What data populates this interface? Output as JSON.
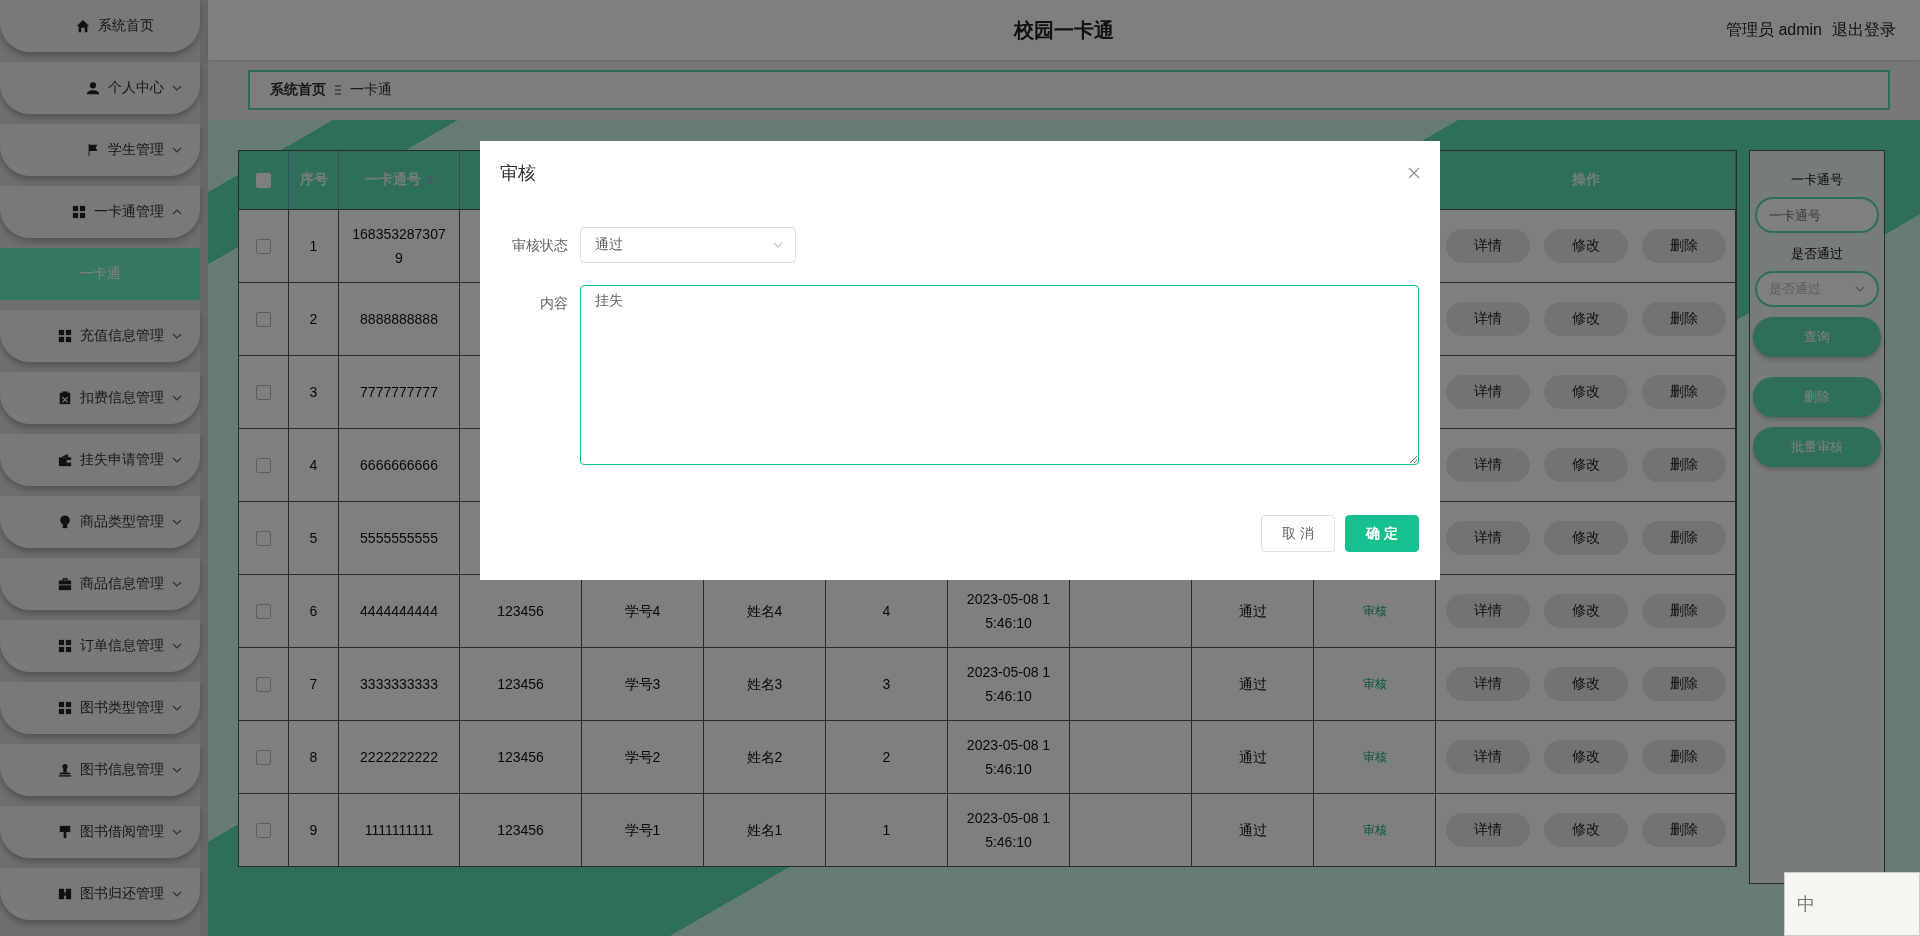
{
  "header": {
    "title": "校园一卡通",
    "user": "管理员 admin",
    "logout": "退出登录"
  },
  "sidebar": {
    "items": [
      {
        "label": "系统首页",
        "kind": "link"
      },
      {
        "label": "个人中心",
        "kind": "menu",
        "expanded": false
      },
      {
        "label": "学生管理",
        "kind": "menu",
        "expanded": false
      },
      {
        "label": "一卡通管理",
        "kind": "menu",
        "expanded": true,
        "children": [
          {
            "label": "一卡通",
            "selected": true
          }
        ]
      },
      {
        "label": "充值信息管理",
        "kind": "menu",
        "expanded": false
      },
      {
        "label": "扣费信息管理",
        "kind": "menu",
        "expanded": false
      },
      {
        "label": "挂失申请管理",
        "kind": "menu",
        "expanded": false
      },
      {
        "label": "商品类型管理",
        "kind": "menu",
        "expanded": false
      },
      {
        "label": "商品信息管理",
        "kind": "menu",
        "expanded": false
      },
      {
        "label": "订单信息管理",
        "kind": "menu",
        "expanded": false
      },
      {
        "label": "图书类型管理",
        "kind": "menu",
        "expanded": false
      },
      {
        "label": "图书信息管理",
        "kind": "menu",
        "expanded": false
      },
      {
        "label": "图书借阅管理",
        "kind": "menu",
        "expanded": false
      },
      {
        "label": "图书归还管理",
        "kind": "menu",
        "expanded": false
      }
    ]
  },
  "breadcrumb": [
    "系统首页",
    "一卡通"
  ],
  "table": {
    "select_all_checked": false,
    "header": {
      "seq": "序号",
      "card_no": "一卡通号",
      "actions": "操作"
    },
    "rows": [
      {
        "checked": false,
        "seq": "1",
        "card_no": "1683532873079",
        "actions": [
          "详情",
          "修改",
          "删除"
        ]
      },
      {
        "checked": false,
        "seq": "2",
        "card_no": "8888888888",
        "actions": [
          "详情",
          "修改",
          "删除"
        ]
      },
      {
        "checked": false,
        "seq": "3",
        "card_no": "7777777777",
        "actions": [
          "详情",
          "修改",
          "删除"
        ]
      },
      {
        "checked": false,
        "seq": "4",
        "card_no": "6666666666",
        "actions": [
          "详情",
          "修改",
          "删除"
        ]
      },
      {
        "checked": false,
        "seq": "5",
        "card_no": "5555555555",
        "actions": [
          "详情",
          "修改",
          "删除"
        ]
      },
      {
        "checked": false,
        "seq": "6",
        "card_no": "4444444444",
        "column_4": "123456",
        "column_5": "学号4",
        "column_6": "姓名4",
        "column_7": "4",
        "column_8": "2023-05-08 15:46:10",
        "status": "通过",
        "audit_link": "审核",
        "actions": [
          "详情",
          "修改",
          "删除"
        ]
      },
      {
        "checked": false,
        "seq": "7",
        "card_no": "3333333333",
        "column_4": "123456",
        "column_5": "学号3",
        "column_6": "姓名3",
        "column_7": "3",
        "column_8": "2023-05-08 15:46:10",
        "status": "通过",
        "audit_link": "审核",
        "actions": [
          "详情",
          "修改",
          "删除"
        ]
      },
      {
        "checked": false,
        "seq": "8",
        "card_no": "2222222222",
        "column_4": "123456",
        "column_5": "学号2",
        "column_6": "姓名2",
        "column_7": "2",
        "column_8": "2023-05-08 15:46:10",
        "status": "通过",
        "audit_link": "审核",
        "actions": [
          "详情",
          "修改",
          "删除"
        ]
      },
      {
        "checked": false,
        "seq": "9",
        "card_no": "1111111111",
        "column_4": "123456",
        "column_5": "学号1",
        "column_6": "姓名1",
        "column_7": "1",
        "column_8": "2023-05-08 15:46:10",
        "status": "通过",
        "audit_link": "审核",
        "actions": [
          "详情",
          "修改",
          "删除"
        ]
      }
    ]
  },
  "search_panel": {
    "card_label": "一卡通号",
    "card_placeholder": "一卡通号",
    "pass_label": "是否通过",
    "pass_placeholder": "是否通过",
    "buttons": [
      "查询",
      "删除",
      "批量审核"
    ]
  },
  "dialog": {
    "title": "审核",
    "status_label": "审核状态",
    "status_value": "通过",
    "content_label": "内容",
    "content_value": "挂失",
    "buttons": [
      {
        "label": "取 消",
        "kind": "secondary"
      },
      {
        "label": "确 定",
        "kind": "primary"
      }
    ]
  },
  "ime": {
    "label": "中"
  }
}
